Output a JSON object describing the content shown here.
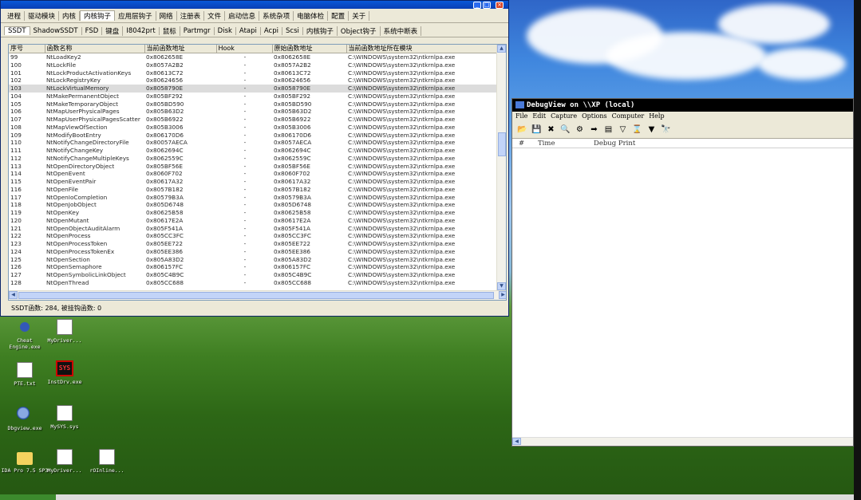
{
  "menubar": {
    "items": [
      "进程",
      "驱动模块",
      "内核",
      "内核钩子",
      "应用层钩子",
      "网络",
      "注册表",
      "文件",
      "启动信息",
      "系统杂项",
      "电脑体检",
      "配置",
      "关于"
    ]
  },
  "subtabs": {
    "items": [
      "SSDT",
      "ShadowSSDT",
      "FSD",
      "键盘",
      "I8042prt",
      "鼠标",
      "Partmgr",
      "Disk",
      "Atapi",
      "Acpi",
      "Scsi",
      "内核钩子",
      "Object钩子",
      "系统中断表"
    ]
  },
  "table": {
    "columns": [
      "序号",
      "函数名称",
      "当前函数地址",
      "Hook",
      "原始函数地址",
      "当前函数地址所在模块"
    ],
    "rows": [
      [
        "99",
        "NtLoadKey2",
        "0x8062658E",
        "-",
        "0x8062658E",
        "C:\\WINDOWS\\system32\\ntkrnlpa.exe"
      ],
      [
        "100",
        "NtLockFile",
        "0x8057A2B2",
        "-",
        "0x8057A2B2",
        "C:\\WINDOWS\\system32\\ntkrnlpa.exe"
      ],
      [
        "101",
        "NtLockProductActivationKeys",
        "0x80613C72",
        "-",
        "0x80613C72",
        "C:\\WINDOWS\\system32\\ntkrnlpa.exe"
      ],
      [
        "102",
        "NtLockRegistryKey",
        "0x80624656",
        "-",
        "0x80624656",
        "C:\\WINDOWS\\system32\\ntkrnlpa.exe"
      ],
      [
        "103",
        "NtLockVirtualMemory",
        "0x8058790E",
        "-",
        "0x8058790E",
        "C:\\WINDOWS\\system32\\ntkrnlpa.exe"
      ],
      [
        "104",
        "NtMakePermanentObject",
        "0x805BF292",
        "-",
        "0x805BF292",
        "C:\\WINDOWS\\system32\\ntkrnlpa.exe"
      ],
      [
        "105",
        "NtMakeTemporaryObject",
        "0x805BD590",
        "-",
        "0x805BD590",
        "C:\\WINDOWS\\system32\\ntkrnlpa.exe"
      ],
      [
        "106",
        "NtMapUserPhysicalPages",
        "0x805B63D2",
        "-",
        "0x805B63D2",
        "C:\\WINDOWS\\system32\\ntkrnlpa.exe"
      ],
      [
        "107",
        "NtMapUserPhysicalPagesScatter",
        "0x805B6922",
        "-",
        "0x805B6922",
        "C:\\WINDOWS\\system32\\ntkrnlpa.exe"
      ],
      [
        "108",
        "NtMapViewOfSection",
        "0x805B3006",
        "-",
        "0x805B3006",
        "C:\\WINDOWS\\system32\\ntkrnlpa.exe"
      ],
      [
        "109",
        "NtModifyBootEntry",
        "0x806170D6",
        "-",
        "0x806170D6",
        "C:\\WINDOWS\\system32\\ntkrnlpa.exe"
      ],
      [
        "110",
        "NtNotifyChangeDirectoryFile",
        "0x80057AECA",
        "-",
        "0x8057AECA",
        "C:\\WINDOWS\\system32\\ntkrnlpa.exe"
      ],
      [
        "111",
        "NtNotifyChangeKey",
        "0x8062694C",
        "-",
        "0x8062694C",
        "C:\\WINDOWS\\system32\\ntkrnlpa.exe"
      ],
      [
        "112",
        "NtNotifyChangeMultipleKeys",
        "0x8062559C",
        "-",
        "0x8062559C",
        "C:\\WINDOWS\\system32\\ntkrnlpa.exe"
      ],
      [
        "113",
        "NtOpenDirectoryObject",
        "0x805BF56E",
        "-",
        "0x805BF56E",
        "C:\\WINDOWS\\system32\\ntkrnlpa.exe"
      ],
      [
        "114",
        "NtOpenEvent",
        "0x8060F702",
        "-",
        "0x8060F702",
        "C:\\WINDOWS\\system32\\ntkrnlpa.exe"
      ],
      [
        "115",
        "NtOpenEventPair",
        "0x80617A32",
        "-",
        "0x80617A32",
        "C:\\WINDOWS\\system32\\ntkrnlpa.exe"
      ],
      [
        "116",
        "NtOpenFile",
        "0x8057B182",
        "-",
        "0x8057B182",
        "C:\\WINDOWS\\system32\\ntkrnlpa.exe"
      ],
      [
        "117",
        "NtOpenIoCompletion",
        "0x80579B3A",
        "-",
        "0x80579B3A",
        "C:\\WINDOWS\\system32\\ntkrnlpa.exe"
      ],
      [
        "118",
        "NtOpenJobObject",
        "0x805D6748",
        "-",
        "0x805D6748",
        "C:\\WINDOWS\\system32\\ntkrnlpa.exe"
      ],
      [
        "119",
        "NtOpenKey",
        "0x80625B58",
        "-",
        "0x80625B58",
        "C:\\WINDOWS\\system32\\ntkrnlpa.exe"
      ],
      [
        "120",
        "NtOpenMutant",
        "0x80617E2A",
        "-",
        "0x80617E2A",
        "C:\\WINDOWS\\system32\\ntkrnlpa.exe"
      ],
      [
        "121",
        "NtOpenObjectAuditAlarm",
        "0x805F541A",
        "-",
        "0x805F541A",
        "C:\\WINDOWS\\system32\\ntkrnlpa.exe"
      ],
      [
        "122",
        "NtOpenProcess",
        "0x805CC3FC",
        "-",
        "0x805CC3FC",
        "C:\\WINDOWS\\system32\\ntkrnlpa.exe"
      ],
      [
        "123",
        "NtOpenProcessToken",
        "0x805EE722",
        "-",
        "0x805EE722",
        "C:\\WINDOWS\\system32\\ntkrnlpa.exe"
      ],
      [
        "124",
        "NtOpenProcessTokenEx",
        "0x805EE386",
        "-",
        "0x805EE386",
        "C:\\WINDOWS\\system32\\ntkrnlpa.exe"
      ],
      [
        "125",
        "NtOpenSection",
        "0x805A83D2",
        "-",
        "0x805A83D2",
        "C:\\WINDOWS\\system32\\ntkrnlpa.exe"
      ],
      [
        "126",
        "NtOpenSemaphore",
        "0x806157FC",
        "-",
        "0x806157FC",
        "C:\\WINDOWS\\system32\\ntkrnlpa.exe"
      ],
      [
        "127",
        "NtOpenSymbolicLinkObject",
        "0x805C4B9C",
        "-",
        "0x805C4B9C",
        "C:\\WINDOWS\\system32\\ntkrnlpa.exe"
      ],
      [
        "128",
        "NtOpenThread",
        "0x805CC688",
        "-",
        "0x805CC688",
        "C:\\WINDOWS\\system32\\ntkrnlpa.exe"
      ]
    ]
  },
  "status": {
    "text": "SSDT函数: 284, 被挂钩函数: 0"
  },
  "debugview": {
    "title": "DebugView on \\\\XP (local)",
    "menu": [
      "File",
      "Edit",
      "Capture",
      "Options",
      "Computer",
      "Help"
    ],
    "columns": [
      "#",
      "Time",
      "Debug Print"
    ]
  },
  "desktop": {
    "icons": [
      {
        "label": "Cheat Engine.exe",
        "icon": "bug-icon"
      },
      {
        "label": "MyDriver...",
        "icon": "file-icon"
      },
      {
        "label": "PTE.txt",
        "icon": "text-file-icon"
      },
      {
        "label": "InstDrv.exe",
        "icon": "sys-icon",
        "badge": "SYS"
      },
      {
        "label": "Dbgview.exe",
        "icon": "magnifier-icon"
      },
      {
        "label": "MySYS.sys",
        "icon": "file-icon"
      },
      {
        "label": "IDA Pro 7.5 SP3",
        "icon": "folder-icon"
      },
      {
        "label": "MyDriver...",
        "icon": "file-icon"
      },
      {
        "label": "rOInline...",
        "icon": "file-icon"
      }
    ]
  }
}
